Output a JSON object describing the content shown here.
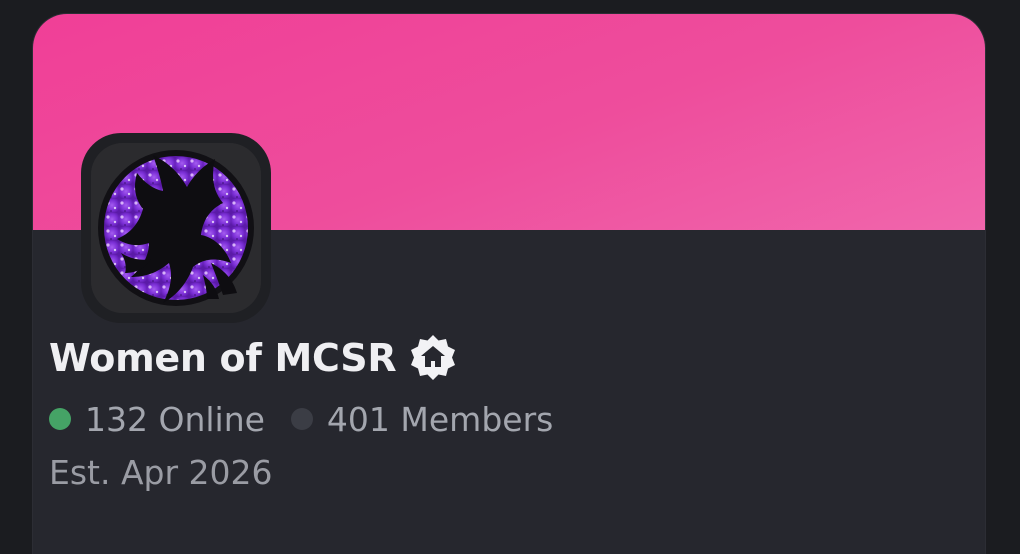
{
  "server": {
    "name": "Women of MCSR",
    "online_text": "132 Online",
    "members_text": "401 Members",
    "established": "Est. Apr 2026"
  },
  "badge": {
    "icon": "home-verified-badge-icon"
  },
  "colors": {
    "banner": "#f04b9c",
    "card_background": "#26272e",
    "page_background": "#1b1c20",
    "online_dot": "#45a366",
    "icon_purple": "#8b3fe0"
  }
}
